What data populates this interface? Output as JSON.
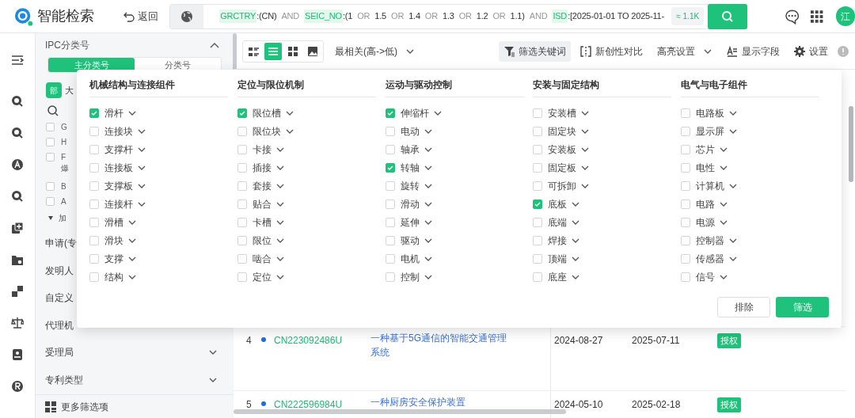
{
  "header": {
    "app_title": "智能检索",
    "back_label": "返回",
    "query": [
      {
        "kind": "field",
        "text": "GRCTRY"
      },
      {
        "kind": "value",
        "text": ":(CN)"
      },
      {
        "kind": "op",
        "text": "AND"
      },
      {
        "kind": "field",
        "text": "SEIC_NO"
      },
      {
        "kind": "value",
        "text": ":(1"
      },
      {
        "kind": "op",
        "text": "OR"
      },
      {
        "kind": "value",
        "text": "1.5"
      },
      {
        "kind": "op",
        "text": "OR"
      },
      {
        "kind": "value",
        "text": "1.4"
      },
      {
        "kind": "op",
        "text": "OR"
      },
      {
        "kind": "value",
        "text": "1.3"
      },
      {
        "kind": "op",
        "text": "OR"
      },
      {
        "kind": "value",
        "text": "1.2"
      },
      {
        "kind": "op",
        "text": "OR"
      },
      {
        "kind": "value",
        "text": "1.1)"
      },
      {
        "kind": "op",
        "text": "AND"
      },
      {
        "kind": "field",
        "text": "ISD"
      },
      {
        "kind": "value",
        "text": ":[2025-01-01 TO 2025-11-"
      }
    ],
    "count": "≈ 1.1K",
    "avatar": "江"
  },
  "sidebar": {
    "section_title": "IPC分类号",
    "tabs": [
      {
        "label": "主分类号",
        "selected": true
      },
      {
        "label": "分类号",
        "selected": false
      }
    ],
    "tag_badge": "部",
    "tag_text": "大",
    "ipc_items": [
      {
        "label": "G",
        "checked": false
      },
      {
        "label": "H",
        "checked": false
      },
      {
        "label": "F",
        "checked": false,
        "second_line": "爆"
      },
      {
        "label": "B",
        "checked": false
      },
      {
        "label": "A",
        "checked": false
      }
    ],
    "load_more": "加",
    "filters": [
      {
        "label": "申请(专"
      },
      {
        "label": "发明人"
      },
      {
        "label": "自定义"
      },
      {
        "label": "代理机"
      },
      {
        "label": "受理局",
        "expandable": true
      },
      {
        "label": "专利类型",
        "expandable": true
      }
    ],
    "more_filters": "更多筛选项"
  },
  "toolbar": {
    "views": [
      {
        "kind": "detail",
        "selected": false
      },
      {
        "kind": "list",
        "selected": true
      },
      {
        "kind": "grid",
        "selected": false
      },
      {
        "kind": "image",
        "selected": false
      }
    ],
    "sort": "最相关(高->低)",
    "actions": [
      {
        "kind": "filter",
        "label": "筛选关键词",
        "selected": true
      },
      {
        "kind": "compare",
        "label": "新创性对比",
        "selected": false
      },
      {
        "kind": "dropdown",
        "label": "高亮设置",
        "selected": false
      },
      {
        "kind": "fields",
        "label": "显示字段",
        "selected": false
      },
      {
        "kind": "settings",
        "label": "设置",
        "selected": false
      }
    ]
  },
  "table": {
    "rows": [
      {
        "index": "4",
        "number": "CN223092486U",
        "title": "一种基于5G通信的智能交通管理系统",
        "date_1": "2024-08-27",
        "date_2": "2025-07-11",
        "status": "授权"
      },
      {
        "index": "5",
        "number": "CN222596984U",
        "title": "一种厨房安全保护装置",
        "date_1": "2024-05-10",
        "date_2": "2025-02-18",
        "status": "授权"
      }
    ]
  },
  "keyword_popup": {
    "groups": [
      {
        "title": "机械结构与连接组件",
        "items": [
          {
            "label": "滑杆",
            "checked": true
          },
          {
            "label": "连接块",
            "checked": false
          },
          {
            "label": "支撑杆",
            "checked": false
          },
          {
            "label": "连接板",
            "checked": false
          },
          {
            "label": "支撑板",
            "checked": false
          },
          {
            "label": "连接杆",
            "checked": false
          },
          {
            "label": "滑槽",
            "checked": false
          },
          {
            "label": "滑块",
            "checked": false
          },
          {
            "label": "支撑",
            "checked": false
          },
          {
            "label": "结构",
            "checked": false
          }
        ]
      },
      {
        "title": "定位与限位机制",
        "items": [
          {
            "label": "限位槽",
            "checked": true
          },
          {
            "label": "限位块",
            "checked": false
          },
          {
            "label": "卡接",
            "checked": false
          },
          {
            "label": "插接",
            "checked": false
          },
          {
            "label": "套接",
            "checked": false
          },
          {
            "label": "贴合",
            "checked": false
          },
          {
            "label": "卡槽",
            "checked": false
          },
          {
            "label": "限位",
            "checked": false
          },
          {
            "label": "啮合",
            "checked": false
          },
          {
            "label": "定位",
            "checked": false
          }
        ]
      },
      {
        "title": "运动与驱动控制",
        "items": [
          {
            "label": "伸缩杆",
            "checked": true
          },
          {
            "label": "电动",
            "checked": false
          },
          {
            "label": "轴承",
            "checked": false
          },
          {
            "label": "转轴",
            "checked": true
          },
          {
            "label": "旋转",
            "checked": false
          },
          {
            "label": "滑动",
            "checked": false
          },
          {
            "label": "延伸",
            "checked": false
          },
          {
            "label": "驱动",
            "checked": false
          },
          {
            "label": "电机",
            "checked": false
          },
          {
            "label": "控制",
            "checked": false
          }
        ]
      },
      {
        "title": "安装与固定结构",
        "items": [
          {
            "label": "安装槽",
            "checked": false
          },
          {
            "label": "固定块",
            "checked": false
          },
          {
            "label": "安装板",
            "checked": false
          },
          {
            "label": "固定板",
            "checked": false
          },
          {
            "label": "可拆卸",
            "checked": false
          },
          {
            "label": "底板",
            "checked": true
          },
          {
            "label": "底端",
            "checked": false
          },
          {
            "label": "焊接",
            "checked": false
          },
          {
            "label": "顶端",
            "checked": false
          },
          {
            "label": "底座",
            "checked": false
          }
        ]
      },
      {
        "title": "电气与电子组件",
        "items": [
          {
            "label": "电路板",
            "checked": false
          },
          {
            "label": "显示屏",
            "checked": false
          },
          {
            "label": "芯片",
            "checked": false
          },
          {
            "label": "电性",
            "checked": false
          },
          {
            "label": "计算机",
            "checked": false
          },
          {
            "label": "电路",
            "checked": false
          },
          {
            "label": "电源",
            "checked": false
          },
          {
            "label": "控制器",
            "checked": false
          },
          {
            "label": "传感器",
            "checked": false
          },
          {
            "label": "信号",
            "checked": false
          }
        ]
      }
    ],
    "buttons": [
      {
        "kind": "secondary",
        "label": "排除"
      },
      {
        "kind": "primary",
        "label": "筛选"
      }
    ]
  }
}
